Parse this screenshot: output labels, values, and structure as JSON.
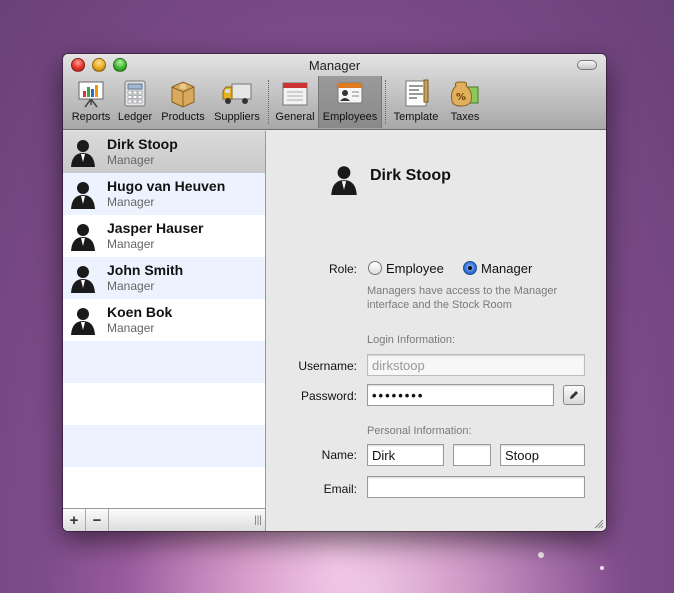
{
  "window": {
    "title": "Manager"
  },
  "toolbar": {
    "items": [
      {
        "label": "Reports",
        "icon": "reports-icon"
      },
      {
        "label": "Ledger",
        "icon": "ledger-icon"
      },
      {
        "label": "Products",
        "icon": "products-icon"
      },
      {
        "label": "Suppliers",
        "icon": "suppliers-icon"
      },
      {
        "label": "General",
        "icon": "general-icon"
      },
      {
        "label": "Employees",
        "icon": "employees-icon"
      },
      {
        "label": "Template",
        "icon": "template-icon"
      },
      {
        "label": "Taxes",
        "icon": "taxes-icon"
      }
    ],
    "selected": "Employees"
  },
  "employees": [
    {
      "name": "Dirk Stoop",
      "role": "Manager"
    },
    {
      "name": "Hugo van Heuven",
      "role": "Manager"
    },
    {
      "name": "Jasper Hauser",
      "role": "Manager"
    },
    {
      "name": "John Smith",
      "role": "Manager"
    },
    {
      "name": "Koen Bok",
      "role": "Manager"
    }
  ],
  "sidebar_footer": {
    "add_label": "+",
    "remove_label": "−",
    "grip": "|||"
  },
  "detail": {
    "name": "Dirk Stoop",
    "role_label": "Role:",
    "role_options": {
      "employee": "Employee",
      "manager": "Manager"
    },
    "selected_role": "Manager",
    "role_hint": "Managers have access to the Manager interface and the Stock Room",
    "login_section": "Login Information:",
    "username_label": "Username:",
    "username_value": "dirkstoop",
    "password_label": "Password:",
    "password_value": "••••••••",
    "personal_section": "Personal Information:",
    "name_label": "Name:",
    "first_name": "Dirk",
    "middle_name": "",
    "last_name": "Stoop",
    "email_label": "Email:",
    "email_value": ""
  },
  "colors": {
    "selection_gray": "#cfcfcf",
    "alt_row": "#edf3fe",
    "radio_on": "#2f6fd6"
  }
}
